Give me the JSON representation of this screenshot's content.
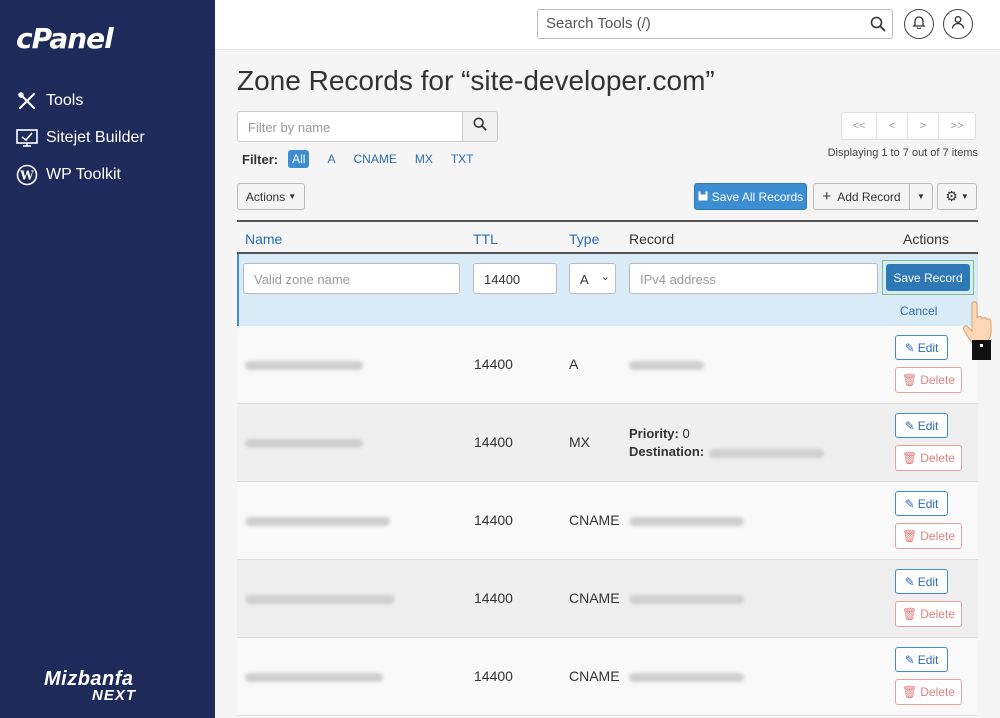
{
  "sidebar": {
    "logo": "cPanel",
    "items": [
      {
        "label": "Tools",
        "icon": "tools-icon"
      },
      {
        "label": "Sitejet Builder",
        "icon": "sitejet-icon"
      },
      {
        "label": "WP Toolkit",
        "icon": "wordpress-icon"
      }
    ],
    "brand_line1": "Mizbanfa",
    "brand_line2": "NEXT"
  },
  "topbar": {
    "search_placeholder": "Search Tools (/)"
  },
  "page": {
    "title": "Zone Records for “site-developer.com”",
    "filter_placeholder": "Filter by name",
    "filter_label": "Filter:",
    "filters": [
      "All",
      "A",
      "CNAME",
      "MX",
      "TXT"
    ],
    "active_filter": "All",
    "pager": [
      "<<",
      "<",
      ">",
      ">>"
    ],
    "displaying": "Displaying 1 to 7 out of 7 items",
    "actions_label": "Actions",
    "save_all_label": "Save All Records",
    "add_record_label": "Add Record"
  },
  "table": {
    "headers": {
      "name": "Name",
      "ttl": "TTL",
      "type": "Type",
      "record": "Record",
      "actions": "Actions"
    },
    "new_row": {
      "name_placeholder": "Valid zone name",
      "ttl_value": "14400",
      "type_value": "A",
      "record_placeholder": "IPv4 address",
      "save_label": "Save Record",
      "cancel_label": "Cancel"
    },
    "rows": [
      {
        "ttl": "14400",
        "type": "A"
      },
      {
        "ttl": "14400",
        "type": "MX",
        "priority_label": "Priority:",
        "priority_value": "0",
        "destination_label": "Destination:"
      },
      {
        "ttl": "14400",
        "type": "CNAME"
      },
      {
        "ttl": "14400",
        "type": "CNAME"
      },
      {
        "ttl": "14400",
        "type": "CNAME"
      }
    ],
    "edit_label": "Edit",
    "delete_label": "Delete"
  },
  "colors": {
    "sidebar": "#1e2a5a",
    "primary": "#3c8dd1",
    "link": "#2a6db5",
    "danger": "#e08080",
    "new_row_bg": "#d9ebf7"
  }
}
